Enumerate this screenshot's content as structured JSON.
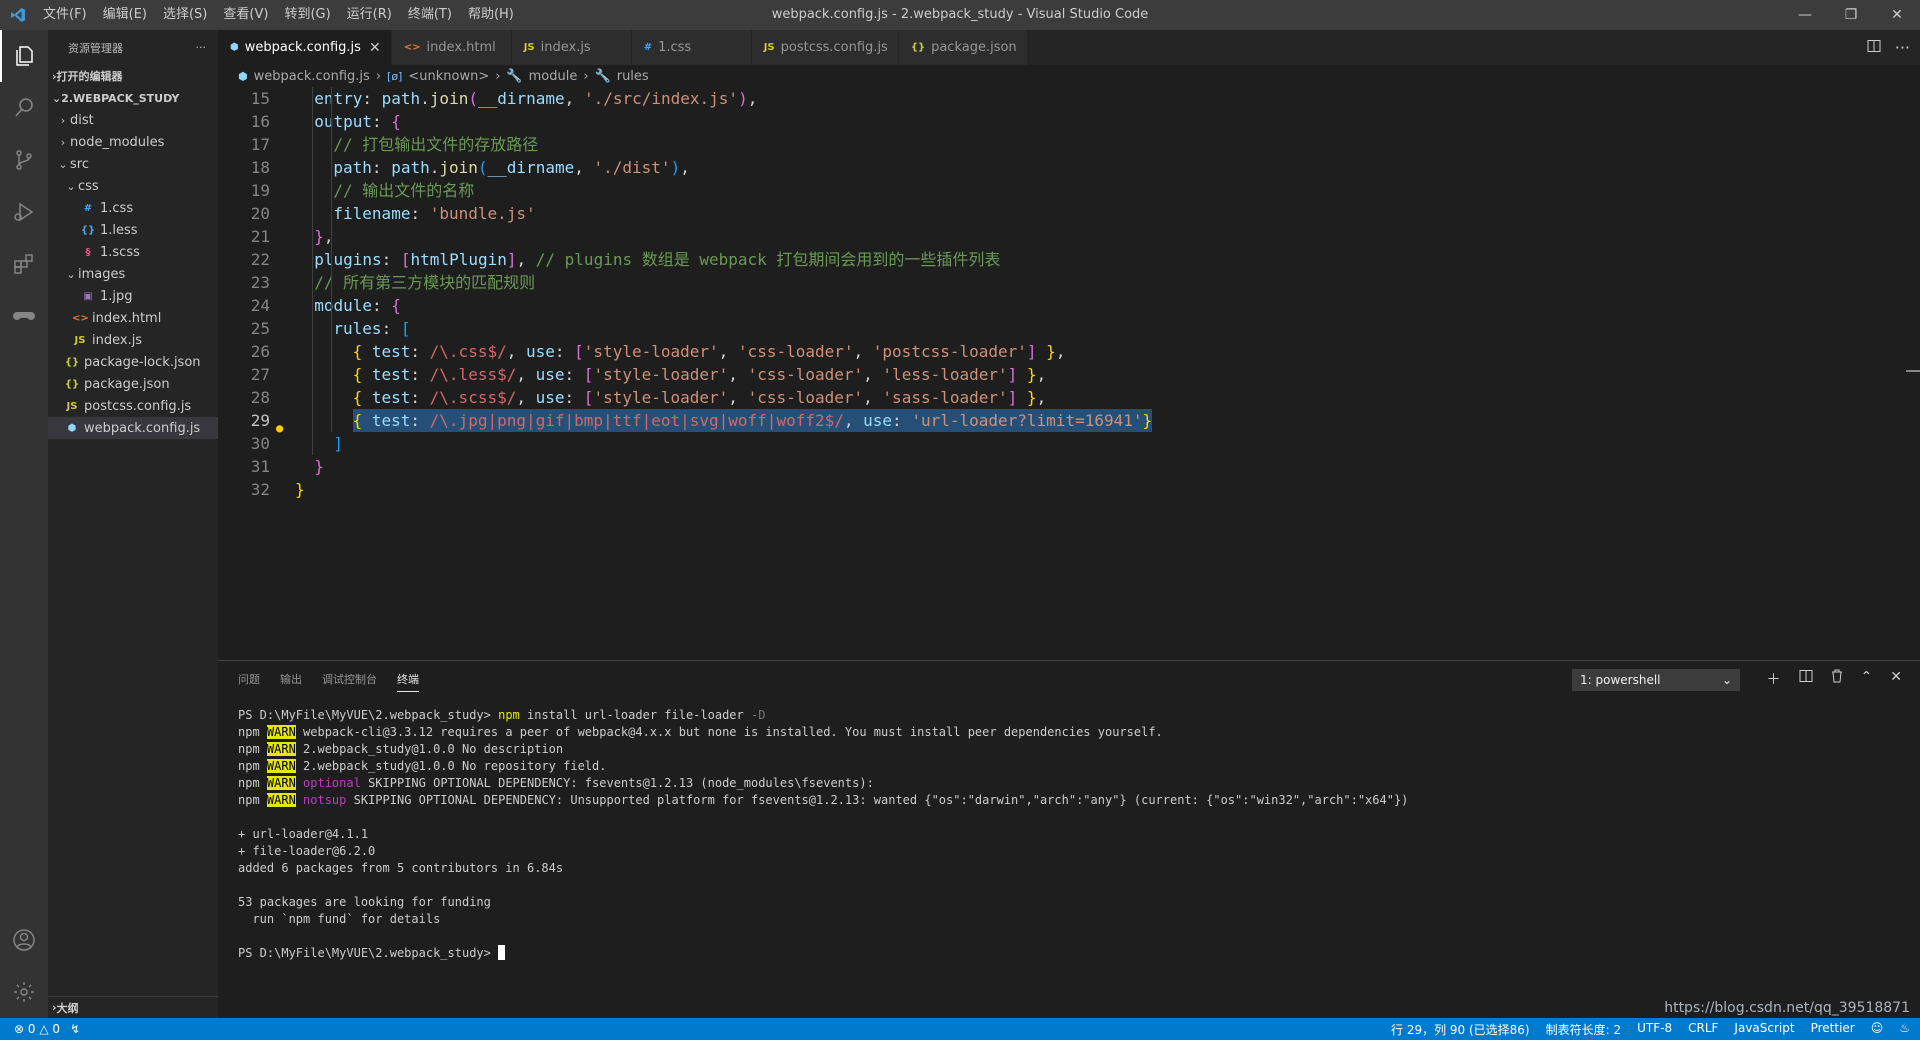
{
  "titlebar": {
    "menu": [
      "文件(F)",
      "编辑(E)",
      "选择(S)",
      "查看(V)",
      "转到(G)",
      "运行(R)",
      "终端(T)",
      "帮助(H)"
    ],
    "title": "webpack.config.js - 2.webpack_study - Visual Studio Code"
  },
  "sidebar": {
    "header": "资源管理器",
    "open_editors": "打开的编辑器",
    "project": "2.WEBPACK_STUDY",
    "tree": [
      {
        "label": "dist",
        "type": "folder",
        "depth": 1,
        "open": false
      },
      {
        "label": "node_modules",
        "type": "folder",
        "depth": 1,
        "open": false
      },
      {
        "label": "src",
        "type": "folder",
        "depth": 1,
        "open": true
      },
      {
        "label": "css",
        "type": "folder",
        "depth": 2,
        "open": true
      },
      {
        "label": "1.css",
        "type": "css",
        "depth": 3
      },
      {
        "label": "1.less",
        "type": "less",
        "depth": 3
      },
      {
        "label": "1.scss",
        "type": "scss",
        "depth": 3
      },
      {
        "label": "images",
        "type": "folder",
        "depth": 2,
        "open": true
      },
      {
        "label": "1.jpg",
        "type": "image",
        "depth": 3
      },
      {
        "label": "index.html",
        "type": "html",
        "depth": 2
      },
      {
        "label": "index.js",
        "type": "js",
        "depth": 2
      },
      {
        "label": "package-lock.json",
        "type": "json",
        "depth": 1
      },
      {
        "label": "package.json",
        "type": "json",
        "depth": 1
      },
      {
        "label": "postcss.config.js",
        "type": "js",
        "depth": 1
      },
      {
        "label": "webpack.config.js",
        "type": "webpack",
        "depth": 1,
        "selected": true
      }
    ],
    "outline": "大纲"
  },
  "tabs": [
    {
      "label": "webpack.config.js",
      "icon": "webpack",
      "active": true
    },
    {
      "label": "index.html",
      "icon": "html"
    },
    {
      "label": "index.js",
      "icon": "js"
    },
    {
      "label": "1.css",
      "icon": "css"
    },
    {
      "label": "postcss.config.js",
      "icon": "js"
    },
    {
      "label": "package.json",
      "icon": "json"
    }
  ],
  "breadcrumb": [
    "webpack.config.js",
    "<unknown>",
    "module",
    "rules"
  ],
  "editor": {
    "lines": [
      {
        "n": "15",
        "indent": 1,
        "tokens": [
          [
            "k",
            "entry"
          ],
          [
            "p",
            ": "
          ],
          [
            "k",
            "path"
          ],
          [
            "p",
            "."
          ],
          [
            "f",
            "join"
          ],
          [
            "b2",
            "("
          ],
          [
            "k",
            "__dirname"
          ],
          [
            "p",
            ", "
          ],
          [
            "s",
            "'./src/index.js'"
          ],
          [
            "b2",
            ")"
          ],
          [
            "p",
            ","
          ]
        ]
      },
      {
        "n": "16",
        "indent": 1,
        "tokens": [
          [
            "k",
            "output"
          ],
          [
            "p",
            ": "
          ],
          [
            "b2",
            "{"
          ]
        ]
      },
      {
        "n": "17",
        "indent": 2,
        "tokens": [
          [
            "c",
            "// 打包输出文件的存放路径"
          ]
        ]
      },
      {
        "n": "18",
        "indent": 2,
        "tokens": [
          [
            "k",
            "path"
          ],
          [
            "p",
            ": "
          ],
          [
            "k",
            "path"
          ],
          [
            "p",
            "."
          ],
          [
            "f",
            "join"
          ],
          [
            "b3",
            "("
          ],
          [
            "k",
            "__dirname"
          ],
          [
            "p",
            ", "
          ],
          [
            "s",
            "'./dist'"
          ],
          [
            "b3",
            ")"
          ],
          [
            "p",
            ","
          ]
        ]
      },
      {
        "n": "19",
        "indent": 2,
        "tokens": [
          [
            "c",
            "// 输出文件的名称"
          ]
        ]
      },
      {
        "n": "20",
        "indent": 2,
        "tokens": [
          [
            "k",
            "filename"
          ],
          [
            "p",
            ": "
          ],
          [
            "s",
            "'bundle.js'"
          ]
        ]
      },
      {
        "n": "21",
        "indent": 1,
        "tokens": [
          [
            "b2",
            "}"
          ],
          [
            "p",
            ","
          ]
        ]
      },
      {
        "n": "22",
        "indent": 1,
        "tokens": [
          [
            "k",
            "plugins"
          ],
          [
            "p",
            ": "
          ],
          [
            "b2",
            "["
          ],
          [
            "k",
            "htmlPlugin"
          ],
          [
            "b2",
            "]"
          ],
          [
            "p",
            ", "
          ],
          [
            "c",
            "// plugins 数组是 webpack 打包期间会用到的一些插件列表"
          ]
        ]
      },
      {
        "n": "23",
        "indent": 1,
        "tokens": [
          [
            "c",
            "// 所有第三方模块的匹配规则"
          ]
        ]
      },
      {
        "n": "24",
        "indent": 1,
        "tokens": [
          [
            "k",
            "module"
          ],
          [
            "p",
            ": "
          ],
          [
            "b2",
            "{"
          ]
        ]
      },
      {
        "n": "25",
        "indent": 2,
        "tokens": [
          [
            "k",
            "rules"
          ],
          [
            "p",
            ": "
          ],
          [
            "b3",
            "["
          ]
        ]
      },
      {
        "n": "26",
        "indent": 3,
        "tokens": [
          [
            "b1",
            "{ "
          ],
          [
            "k",
            "test"
          ],
          [
            "p",
            ": "
          ],
          [
            "r",
            "/\\.css$/"
          ],
          [
            "p",
            ", "
          ],
          [
            "k",
            "use"
          ],
          [
            "p",
            ": "
          ],
          [
            "b2",
            "["
          ],
          [
            "s",
            "'style-loader'"
          ],
          [
            "p",
            ", "
          ],
          [
            "s",
            "'css-loader'"
          ],
          [
            "p",
            ", "
          ],
          [
            "s",
            "'postcss-loader'"
          ],
          [
            "b2",
            "]"
          ],
          [
            "b1",
            " }"
          ],
          [
            "p",
            ","
          ]
        ]
      },
      {
        "n": "27",
        "indent": 3,
        "tokens": [
          [
            "b1",
            "{ "
          ],
          [
            "k",
            "test"
          ],
          [
            "p",
            ": "
          ],
          [
            "r",
            "/\\.less$/"
          ],
          [
            "p",
            ", "
          ],
          [
            "k",
            "use"
          ],
          [
            "p",
            ": "
          ],
          [
            "b2",
            "["
          ],
          [
            "s",
            "'style-loader'"
          ],
          [
            "p",
            ", "
          ],
          [
            "s",
            "'css-loader'"
          ],
          [
            "p",
            ", "
          ],
          [
            "s",
            "'less-loader'"
          ],
          [
            "b2",
            "]"
          ],
          [
            "b1",
            " }"
          ],
          [
            "p",
            ","
          ]
        ]
      },
      {
        "n": "28",
        "indent": 3,
        "tokens": [
          [
            "b1",
            "{ "
          ],
          [
            "k",
            "test"
          ],
          [
            "p",
            ": "
          ],
          [
            "r",
            "/\\.scss$/"
          ],
          [
            "p",
            ", "
          ],
          [
            "k",
            "use"
          ],
          [
            "p",
            ": "
          ],
          [
            "b2",
            "["
          ],
          [
            "s",
            "'style-loader'"
          ],
          [
            "p",
            ", "
          ],
          [
            "s",
            "'css-loader'"
          ],
          [
            "p",
            ", "
          ],
          [
            "s",
            "'sass-loader'"
          ],
          [
            "b2",
            "]"
          ],
          [
            "b1",
            " }"
          ],
          [
            "p",
            ","
          ]
        ]
      },
      {
        "n": "29",
        "indent": 3,
        "current": true,
        "tokens": [
          [
            "b1",
            "{ "
          ],
          [
            "k",
            "test"
          ],
          [
            "p",
            ": "
          ],
          [
            "r",
            "/\\.jpg|png|gif|bmp|ttf|eot|svg|woff|woff2$/"
          ],
          [
            "p",
            ", "
          ],
          [
            "k",
            "use"
          ],
          [
            "p",
            ": "
          ],
          [
            "s",
            "'url-loader?limit=16941'"
          ],
          [
            "b1",
            "}"
          ]
        ]
      },
      {
        "n": "30",
        "indent": 2,
        "tokens": [
          [
            "b3",
            "]"
          ]
        ]
      },
      {
        "n": "31",
        "indent": 1,
        "tokens": [
          [
            "b2",
            "}"
          ]
        ]
      },
      {
        "n": "32",
        "indent": 0,
        "tokens": [
          [
            "b1",
            "}"
          ]
        ]
      }
    ]
  },
  "panel": {
    "tabs": [
      "问题",
      "输出",
      "调试控制台",
      "终端"
    ],
    "active_tab": "终端",
    "terminal_select": "1: powershell",
    "terminal_lines": [
      [
        [
          "t",
          "PS D:\\MyFile\\MyVUE\\2.webpack_study> "
        ],
        [
          "cmd",
          "npm"
        ],
        [
          "t",
          " install url-loader file-loader "
        ],
        [
          "dim",
          "-D"
        ]
      ],
      [
        [
          "t",
          "npm "
        ],
        [
          "warn",
          "WARN"
        ],
        [
          "t",
          " webpack-cli@3.3.12 requires a peer of webpack@4.x.x but none is installed. You must install peer dependencies yourself."
        ]
      ],
      [
        [
          "t",
          "npm "
        ],
        [
          "warn",
          "WARN"
        ],
        [
          "t",
          " 2.webpack_study@1.0.0 No description"
        ]
      ],
      [
        [
          "t",
          "npm "
        ],
        [
          "warn",
          "WARN"
        ],
        [
          "t",
          " 2.webpack_study@1.0.0 No repository field."
        ]
      ],
      [
        [
          "t",
          "npm "
        ],
        [
          "warn",
          "WARN"
        ],
        [
          "mag",
          " optional"
        ],
        [
          "t",
          " SKIPPING OPTIONAL DEPENDENCY: fsevents@1.2.13 (node_modules\\fsevents):"
        ]
      ],
      [
        [
          "t",
          "npm "
        ],
        [
          "warn",
          "WARN"
        ],
        [
          "mag",
          " notsup"
        ],
        [
          "t",
          " SKIPPING OPTIONAL DEPENDENCY: Unsupported platform for fsevents@1.2.13: wanted {\"os\":\"darwin\",\"arch\":\"any\"} (current: {\"os\":\"win32\",\"arch\":\"x64\"})"
        ]
      ],
      [
        [
          "t",
          ""
        ]
      ],
      [
        [
          "t",
          "+ url-loader@4.1.1"
        ]
      ],
      [
        [
          "t",
          "+ file-loader@6.2.0"
        ]
      ],
      [
        [
          "t",
          "added 6 packages from 5 contributors in 6.84s"
        ]
      ],
      [
        [
          "t",
          ""
        ]
      ],
      [
        [
          "t",
          "53 packages are looking for funding"
        ]
      ],
      [
        [
          "t",
          "  run `npm fund` for details"
        ]
      ],
      [
        [
          "t",
          ""
        ]
      ],
      [
        [
          "t",
          "PS D:\\MyFile\\MyVUE\\2.webpack_study> "
        ],
        [
          "cursor",
          ""
        ]
      ]
    ]
  },
  "statusbar": {
    "errors": "0",
    "warnings": "0",
    "position": "行 29，列 90 (已选择86)",
    "tabsize": "制表符长度: 2",
    "encoding": "UTF-8",
    "eol": "CRLF",
    "language": "JavaScript",
    "formatter": "Prettier"
  },
  "watermark": "https://blog.csdn.net/qq_39518871",
  "colors": {
    "accent": "#007acc",
    "editor_bg": "#1e1e1e",
    "sidebar_bg": "#252526"
  }
}
